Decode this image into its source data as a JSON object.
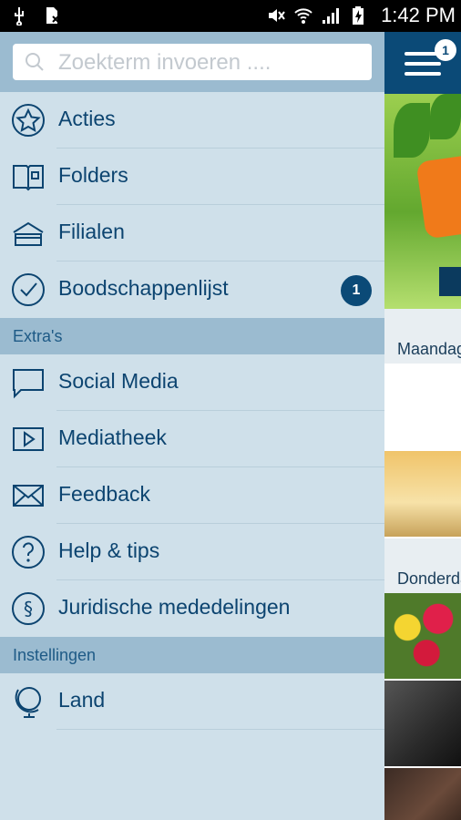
{
  "status_bar": {
    "time": "1:42 PM"
  },
  "search": {
    "placeholder": "Zoekterm invoeren ...."
  },
  "menu": {
    "items": [
      {
        "label": "Acties",
        "icon": "star-icon"
      },
      {
        "label": "Folders",
        "icon": "folder-icon"
      },
      {
        "label": "Filialen",
        "icon": "store-icon"
      },
      {
        "label": "Boodschappenlijst",
        "icon": "check-icon",
        "badge": "1"
      }
    ]
  },
  "extras": {
    "title": "Extra's",
    "items": [
      {
        "label": "Social Media",
        "icon": "speech-bubble-icon"
      },
      {
        "label": "Mediatheek",
        "icon": "play-icon"
      },
      {
        "label": "Feedback",
        "icon": "envelope-icon"
      },
      {
        "label": "Help & tips",
        "icon": "question-icon"
      },
      {
        "label": "Juridische mededelingen",
        "icon": "paragraph-icon"
      }
    ]
  },
  "settings": {
    "title": "Instellingen",
    "items": [
      {
        "label": "Land",
        "icon": "globe-icon"
      }
    ]
  },
  "content": {
    "menu_badge": "1",
    "day_labels": [
      "Maandag",
      "Donderdag"
    ]
  },
  "colors": {
    "drawer_bg": "#cfe0ea",
    "section_bg": "#9bbbd0",
    "brand": "#0b4a77",
    "text": "#0c4470"
  }
}
